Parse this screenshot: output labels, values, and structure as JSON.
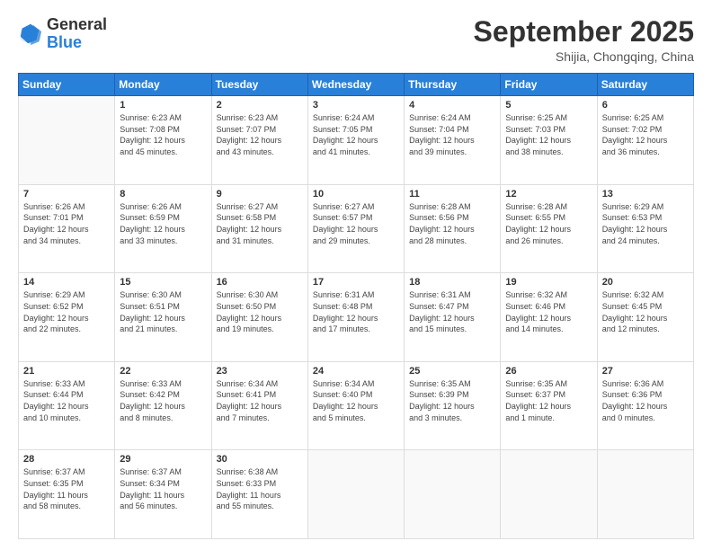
{
  "header": {
    "logo": {
      "general": "General",
      "blue": "Blue"
    },
    "title": "September 2025",
    "location": "Shijia, Chongqing, China"
  },
  "days_of_week": [
    "Sunday",
    "Monday",
    "Tuesday",
    "Wednesday",
    "Thursday",
    "Friday",
    "Saturday"
  ],
  "weeks": [
    [
      {
        "day": "",
        "info": ""
      },
      {
        "day": "1",
        "info": "Sunrise: 6:23 AM\nSunset: 7:08 PM\nDaylight: 12 hours\nand 45 minutes."
      },
      {
        "day": "2",
        "info": "Sunrise: 6:23 AM\nSunset: 7:07 PM\nDaylight: 12 hours\nand 43 minutes."
      },
      {
        "day": "3",
        "info": "Sunrise: 6:24 AM\nSunset: 7:05 PM\nDaylight: 12 hours\nand 41 minutes."
      },
      {
        "day": "4",
        "info": "Sunrise: 6:24 AM\nSunset: 7:04 PM\nDaylight: 12 hours\nand 39 minutes."
      },
      {
        "day": "5",
        "info": "Sunrise: 6:25 AM\nSunset: 7:03 PM\nDaylight: 12 hours\nand 38 minutes."
      },
      {
        "day": "6",
        "info": "Sunrise: 6:25 AM\nSunset: 7:02 PM\nDaylight: 12 hours\nand 36 minutes."
      }
    ],
    [
      {
        "day": "7",
        "info": "Sunrise: 6:26 AM\nSunset: 7:01 PM\nDaylight: 12 hours\nand 34 minutes."
      },
      {
        "day": "8",
        "info": "Sunrise: 6:26 AM\nSunset: 6:59 PM\nDaylight: 12 hours\nand 33 minutes."
      },
      {
        "day": "9",
        "info": "Sunrise: 6:27 AM\nSunset: 6:58 PM\nDaylight: 12 hours\nand 31 minutes."
      },
      {
        "day": "10",
        "info": "Sunrise: 6:27 AM\nSunset: 6:57 PM\nDaylight: 12 hours\nand 29 minutes."
      },
      {
        "day": "11",
        "info": "Sunrise: 6:28 AM\nSunset: 6:56 PM\nDaylight: 12 hours\nand 28 minutes."
      },
      {
        "day": "12",
        "info": "Sunrise: 6:28 AM\nSunset: 6:55 PM\nDaylight: 12 hours\nand 26 minutes."
      },
      {
        "day": "13",
        "info": "Sunrise: 6:29 AM\nSunset: 6:53 PM\nDaylight: 12 hours\nand 24 minutes."
      }
    ],
    [
      {
        "day": "14",
        "info": "Sunrise: 6:29 AM\nSunset: 6:52 PM\nDaylight: 12 hours\nand 22 minutes."
      },
      {
        "day": "15",
        "info": "Sunrise: 6:30 AM\nSunset: 6:51 PM\nDaylight: 12 hours\nand 21 minutes."
      },
      {
        "day": "16",
        "info": "Sunrise: 6:30 AM\nSunset: 6:50 PM\nDaylight: 12 hours\nand 19 minutes."
      },
      {
        "day": "17",
        "info": "Sunrise: 6:31 AM\nSunset: 6:48 PM\nDaylight: 12 hours\nand 17 minutes."
      },
      {
        "day": "18",
        "info": "Sunrise: 6:31 AM\nSunset: 6:47 PM\nDaylight: 12 hours\nand 15 minutes."
      },
      {
        "day": "19",
        "info": "Sunrise: 6:32 AM\nSunset: 6:46 PM\nDaylight: 12 hours\nand 14 minutes."
      },
      {
        "day": "20",
        "info": "Sunrise: 6:32 AM\nSunset: 6:45 PM\nDaylight: 12 hours\nand 12 minutes."
      }
    ],
    [
      {
        "day": "21",
        "info": "Sunrise: 6:33 AM\nSunset: 6:44 PM\nDaylight: 12 hours\nand 10 minutes."
      },
      {
        "day": "22",
        "info": "Sunrise: 6:33 AM\nSunset: 6:42 PM\nDaylight: 12 hours\nand 8 minutes."
      },
      {
        "day": "23",
        "info": "Sunrise: 6:34 AM\nSunset: 6:41 PM\nDaylight: 12 hours\nand 7 minutes."
      },
      {
        "day": "24",
        "info": "Sunrise: 6:34 AM\nSunset: 6:40 PM\nDaylight: 12 hours\nand 5 minutes."
      },
      {
        "day": "25",
        "info": "Sunrise: 6:35 AM\nSunset: 6:39 PM\nDaylight: 12 hours\nand 3 minutes."
      },
      {
        "day": "26",
        "info": "Sunrise: 6:35 AM\nSunset: 6:37 PM\nDaylight: 12 hours\nand 1 minute."
      },
      {
        "day": "27",
        "info": "Sunrise: 6:36 AM\nSunset: 6:36 PM\nDaylight: 12 hours\nand 0 minutes."
      }
    ],
    [
      {
        "day": "28",
        "info": "Sunrise: 6:37 AM\nSunset: 6:35 PM\nDaylight: 11 hours\nand 58 minutes."
      },
      {
        "day": "29",
        "info": "Sunrise: 6:37 AM\nSunset: 6:34 PM\nDaylight: 11 hours\nand 56 minutes."
      },
      {
        "day": "30",
        "info": "Sunrise: 6:38 AM\nSunset: 6:33 PM\nDaylight: 11 hours\nand 55 minutes."
      },
      {
        "day": "",
        "info": ""
      },
      {
        "day": "",
        "info": ""
      },
      {
        "day": "",
        "info": ""
      },
      {
        "day": "",
        "info": ""
      }
    ]
  ]
}
